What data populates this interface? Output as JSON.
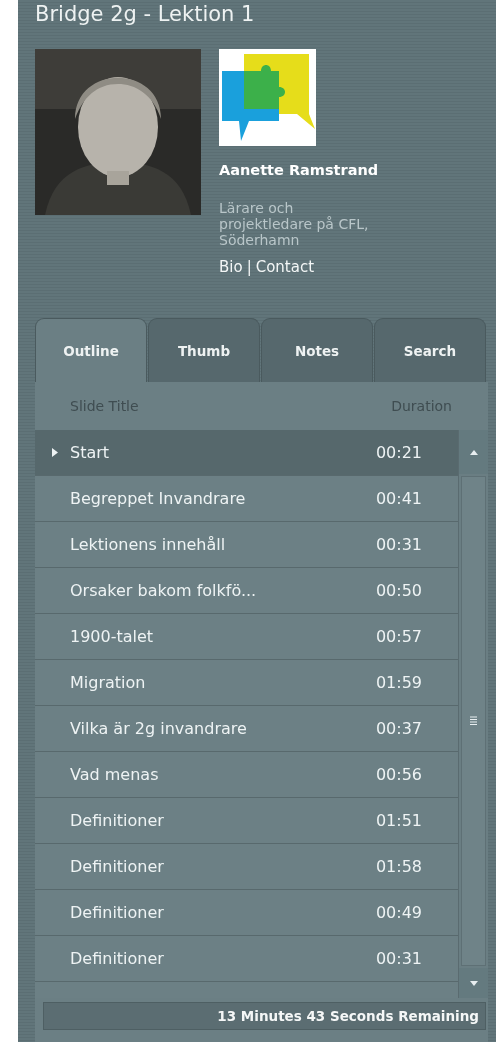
{
  "title": "Bridge 2g - Lektion 1",
  "presenter": {
    "name": "Aanette Ramstrand",
    "description": "Lärare och projektledare på CFL, Söderhamn",
    "links": [
      "Bio",
      "Contact"
    ],
    "separator": "|"
  },
  "tabs": [
    {
      "label": "Outline",
      "selected": true
    },
    {
      "label": "Thumb",
      "selected": false
    },
    {
      "label": "Notes",
      "selected": false
    },
    {
      "label": "Search",
      "selected": false
    }
  ],
  "table": {
    "columns": [
      "Slide Title",
      "Duration"
    ],
    "rows": [
      {
        "title": "Start",
        "duration": "00:21",
        "selected": true
      },
      {
        "title": "Begreppet Invandrare",
        "duration": "00:41",
        "selected": false
      },
      {
        "title": "Lektionens innehåll",
        "duration": "00:31",
        "selected": false
      },
      {
        "title": "Orsaker bakom folkfö...",
        "duration": "00:50",
        "selected": false
      },
      {
        "title": "1900-talet",
        "duration": "00:57",
        "selected": false
      },
      {
        "title": "Migration",
        "duration": "01:59",
        "selected": false
      },
      {
        "title": "Vilka är 2g invandrare",
        "duration": "00:37",
        "selected": false
      },
      {
        "title": "Vad menas",
        "duration": "00:56",
        "selected": false
      },
      {
        "title": "Definitioner",
        "duration": "01:51",
        "selected": false
      },
      {
        "title": "Definitioner",
        "duration": "01:58",
        "selected": false
      },
      {
        "title": "Definitioner",
        "duration": "00:49",
        "selected": false
      },
      {
        "title": "Definitioner",
        "duration": "00:31",
        "selected": false
      }
    ]
  },
  "status_bar": "13 Minutes 43 Seconds Remaining"
}
